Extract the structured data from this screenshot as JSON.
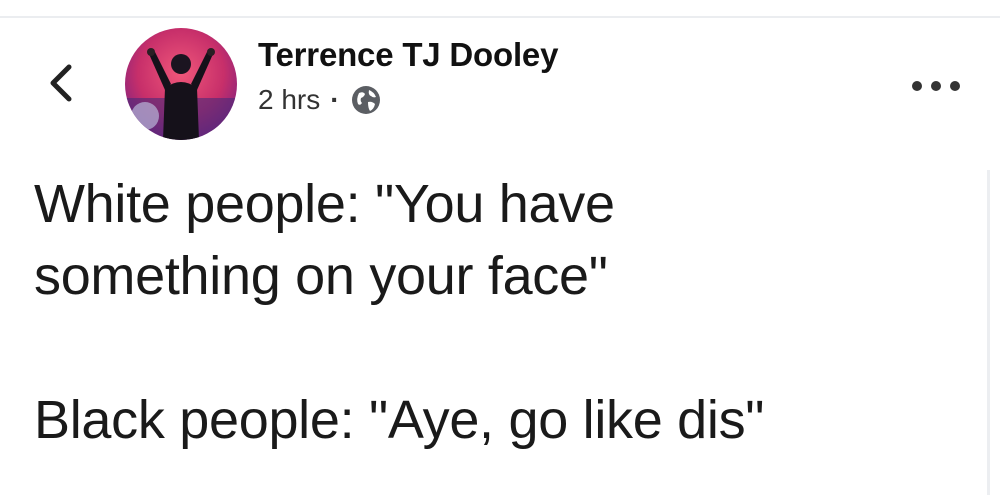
{
  "post": {
    "author": "Terrence TJ Dooley",
    "time": "2 hrs",
    "separator": "·",
    "privacy_icon": "globe-icon",
    "body_line_1": "White people: \"You have\nsomething on your face\"",
    "body_line_2": "Black people: \"Aye, go like dis\""
  },
  "icons": {
    "back": "chevron-left-icon",
    "more": "more-dots-icon"
  }
}
